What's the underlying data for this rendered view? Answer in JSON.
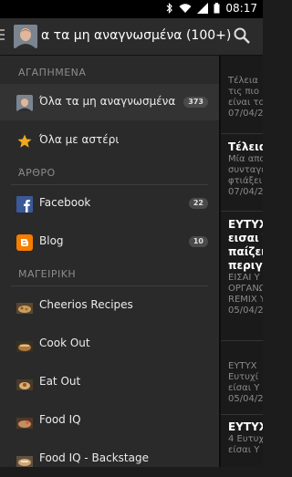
{
  "status": {
    "time": "08:17"
  },
  "header": {
    "title": "α τα μη αναγνωσμένα (100+)",
    "avatar": "user-avatar",
    "search_icon": "search-icon",
    "menu_icon": "drawer-menu-icon"
  },
  "drawer": {
    "sections": [
      {
        "header": "ΑΓΑΠΗΜΕΝΑ"
      },
      {
        "header": "ΆΡΘΡΟ"
      },
      {
        "header": "ΜΑΓΕΙΡΙΚΗ"
      }
    ],
    "items": [
      {
        "label": "Όλα τα μη αναγνωσμένα",
        "badge": "373",
        "icon": "user-avatar"
      },
      {
        "label": "Όλα με αστέρι",
        "icon": "star-icon"
      },
      {
        "label": "Facebook",
        "badge": "22",
        "icon": "facebook-icon"
      },
      {
        "label": "Blog",
        "badge": "10",
        "icon": "blogger-icon"
      },
      {
        "label": "Cheerios Recipes",
        "icon": "feed-thumbnail-icon"
      },
      {
        "label": "Cook Out",
        "icon": "feed-thumbnail-icon"
      },
      {
        "label": "Eat Out",
        "icon": "feed-thumbnail-icon"
      },
      {
        "label": "Food IQ",
        "icon": "feed-thumbnail-icon"
      },
      {
        "label": "Food IQ - Backstage",
        "icon": "feed-thumbnail-icon"
      }
    ]
  },
  "articles": [
    {
      "title": "Τέλεια",
      "snippet": "τις πιο",
      "snippet2": "είναι το",
      "date": "07/04/2",
      "read": true
    },
    {
      "title": "Τέλεια",
      "snippet": "Μία απο",
      "snippet2": "συνταγέ",
      "snippet3": "φτιάξει",
      "date": "07/04/2",
      "read": false
    },
    {
      "title": "ΕΥΤΥΧ",
      "title2": "εισαι Υ",
      "title3": "παίζει",
      "title4": "περιγρ",
      "snippet": "ΕΙΣΑΙ Υ",
      "snippet2": "ΟΡΓΑΝΩ",
      "snippet3": "REMIX Y",
      "date": "05/04/2",
      "read": false
    },
    {
      "title": "ΕΥΤΥΧ",
      "snippet": "Ευτυχί",
      "snippet2": "είσαι Υ",
      "date": "05/04/2",
      "read": true
    },
    {
      "title": "ΕΥΤΥΧ",
      "snippet": "4 Ευτυχ",
      "snippet2": "είσαι Υ",
      "read": false
    }
  ]
}
